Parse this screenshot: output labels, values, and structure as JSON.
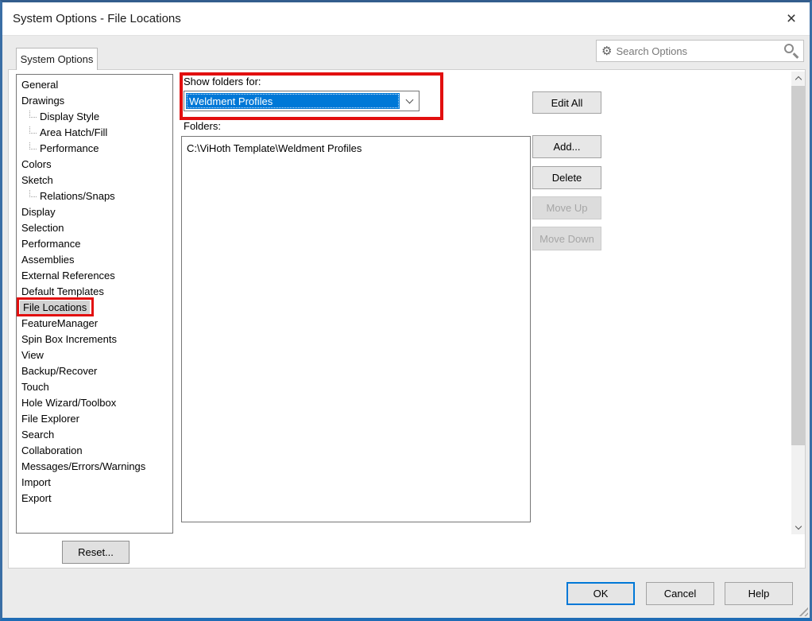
{
  "window": {
    "title": "System Options - File Locations"
  },
  "icons": {
    "close_glyph": "×",
    "gear_glyph": "⚙",
    "search_icon": "magnifier",
    "dropdown_icon": "chevron-down",
    "scroll_up_icon": "chevron-up",
    "scroll_down_icon": "chevron-down"
  },
  "search": {
    "placeholder": "Search Options"
  },
  "tab": {
    "label": "System Options"
  },
  "sidebar": {
    "items": [
      {
        "label": "General",
        "indent": false,
        "selected": false
      },
      {
        "label": "Drawings",
        "indent": false,
        "selected": false
      },
      {
        "label": "Display Style",
        "indent": true,
        "selected": false
      },
      {
        "label": "Area Hatch/Fill",
        "indent": true,
        "selected": false
      },
      {
        "label": "Performance",
        "indent": true,
        "selected": false
      },
      {
        "label": "Colors",
        "indent": false,
        "selected": false
      },
      {
        "label": "Sketch",
        "indent": false,
        "selected": false
      },
      {
        "label": "Relations/Snaps",
        "indent": true,
        "selected": false
      },
      {
        "label": "Display",
        "indent": false,
        "selected": false
      },
      {
        "label": "Selection",
        "indent": false,
        "selected": false
      },
      {
        "label": "Performance",
        "indent": false,
        "selected": false
      },
      {
        "label": "Assemblies",
        "indent": false,
        "selected": false
      },
      {
        "label": "External References",
        "indent": false,
        "selected": false
      },
      {
        "label": "Default Templates",
        "indent": false,
        "selected": false
      },
      {
        "label": "File Locations",
        "indent": false,
        "selected": true,
        "annotated": true
      },
      {
        "label": "FeatureManager",
        "indent": false,
        "selected": false
      },
      {
        "label": "Spin Box Increments",
        "indent": false,
        "selected": false
      },
      {
        "label": "View",
        "indent": false,
        "selected": false
      },
      {
        "label": "Backup/Recover",
        "indent": false,
        "selected": false
      },
      {
        "label": "Touch",
        "indent": false,
        "selected": false
      },
      {
        "label": "Hole Wizard/Toolbox",
        "indent": false,
        "selected": false
      },
      {
        "label": "File Explorer",
        "indent": false,
        "selected": false
      },
      {
        "label": "Search",
        "indent": false,
        "selected": false
      },
      {
        "label": "Collaboration",
        "indent": false,
        "selected": false
      },
      {
        "label": "Messages/Errors/Warnings",
        "indent": false,
        "selected": false
      },
      {
        "label": "Import",
        "indent": false,
        "selected": false
      },
      {
        "label": "Export",
        "indent": false,
        "selected": false
      }
    ]
  },
  "content": {
    "show_folders_label": "Show folders for:",
    "dropdown": {
      "value": "Weldment Profiles"
    },
    "folders_label": "Folders:",
    "folders": [
      "C:\\ViHoth Template\\Weldment Profiles"
    ],
    "actions": [
      {
        "key": "edit-all",
        "label": "Edit All",
        "enabled": true
      },
      {
        "key": "add",
        "label": "Add...",
        "enabled": true
      },
      {
        "key": "delete",
        "label": "Delete",
        "enabled": true
      },
      {
        "key": "move-up",
        "label": "Move Up",
        "enabled": false
      },
      {
        "key": "move-down",
        "label": "Move Down",
        "enabled": false
      }
    ]
  },
  "footer": {
    "reset": "Reset...",
    "ok": "OK",
    "cancel": "Cancel",
    "help": "Help"
  },
  "colors": {
    "accent_blue": "#0078d7",
    "annotation_red": "#e20f0f",
    "selection_gray": "#d2d2d2",
    "window_border_blue": "#3a6ea5"
  }
}
